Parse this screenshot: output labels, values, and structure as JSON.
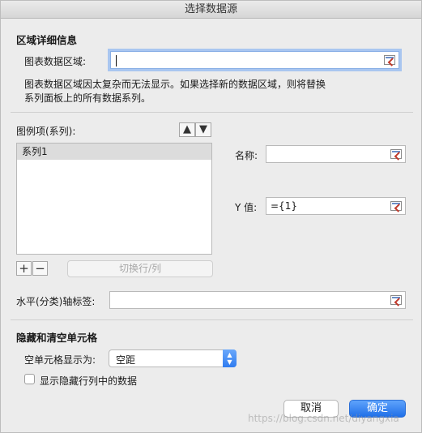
{
  "window": {
    "title": "选择数据源"
  },
  "detail_section": {
    "title": "区域详细信息",
    "range_label": "图表数据区域:",
    "range_value": "",
    "note_line1": "图表数据区域因太复杂而无法显示。如果选择新的数据区域，则将替换",
    "note_line2": "系列面板上的所有数据系列。"
  },
  "legend": {
    "label": "图例项(系列):",
    "move_up_icon": "arrow-up",
    "move_down_icon": "arrow-down",
    "items": [
      "系列1"
    ],
    "add_symbol": "+",
    "remove_symbol": "−",
    "switch_label": "切换行/列"
  },
  "series_detail": {
    "name_label": "名称:",
    "name_value": "",
    "y_label": "Y 值:",
    "y_value": "={1}"
  },
  "axis": {
    "label": "水平(分类)轴标签:",
    "value": ""
  },
  "hidden_section": {
    "title": "隐藏和清空单元格",
    "empty_label": "空单元格显示为:",
    "empty_selected": "空距",
    "show_hidden_label": "显示隐藏行列中的数据",
    "show_hidden_checked": false
  },
  "buttons": {
    "cancel": "取消",
    "ok": "确定"
  },
  "watermark": "https://blog.csdn.net/diyangxia",
  "colors": {
    "accent": "#2f7cf0",
    "focus_ring": "#a9c6f0",
    "background": "#ececec"
  }
}
